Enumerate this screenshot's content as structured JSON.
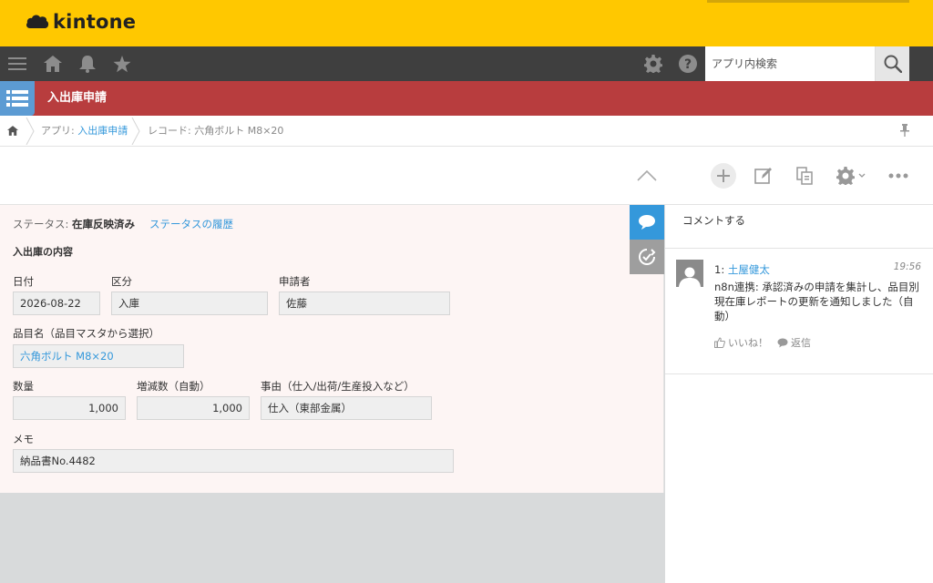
{
  "header": {
    "logo_text": "kintone",
    "search_placeholder": "アプリ内検索"
  },
  "app": {
    "title": "入出庫申請"
  },
  "breadcrumb": {
    "app_prefix": "アプリ: ",
    "app_name": "入出庫申請",
    "record_text": "レコード: 六角ボルト M8×20"
  },
  "status": {
    "label": "ステータス: ",
    "value": "在庫反映済み",
    "history_link": "ステータスの履歴"
  },
  "form": {
    "section_title": "入出庫の内容",
    "fields": {
      "date": {
        "label": "日付",
        "value": "2026-08-22"
      },
      "type": {
        "label": "区分",
        "value": "入庫"
      },
      "applicant": {
        "label": "申請者",
        "value": "佐藤"
      },
      "item": {
        "label": "品目名（品目マスタから選択）",
        "value": "六角ボルト M8×20"
      },
      "qty": {
        "label": "数量",
        "value": "1,000"
      },
      "delta": {
        "label": "増減数（自動）",
        "value": "1,000"
      },
      "reason": {
        "label": "事由（仕入/出荷/生産投入など）",
        "value": "仕入（東部金属）"
      },
      "memo": {
        "label": "メモ",
        "value": "納品書No.4482"
      }
    }
  },
  "comments": {
    "input_placeholder": "コメントする",
    "items": [
      {
        "index": "1: ",
        "author": "土屋健太",
        "time": "19:56",
        "body": "n8n連携: 承認済みの申請を集計し、品目別現在庫レポートの更新を通知しました（自動）",
        "like_label": "いいね！",
        "reply_label": "返信"
      }
    ]
  },
  "colors": {
    "header_yellow": "#ffc800",
    "navbar": "#3f3f3f",
    "app_bar": "#b83d3e",
    "link": "#3498db"
  }
}
